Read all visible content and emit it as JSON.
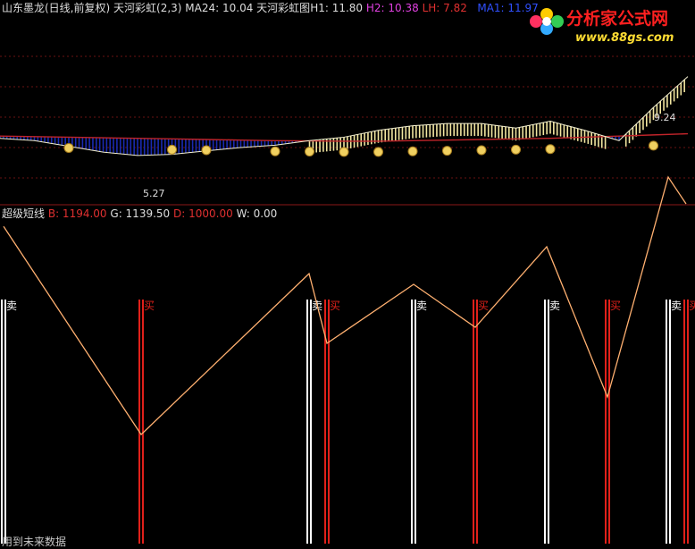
{
  "header_top": {
    "stock_title": "山东墨龙(日线,前复权)",
    "indicator": "天河彩虹(2,3)",
    "ma24": "MA24: 10.04",
    "rainbow": "天河彩虹图",
    "h1": "H1: 11.80",
    "h2": "H2: 10.38",
    "lh": "LH: 7.82",
    "ma1": "MA1: 11.97"
  },
  "header_bottom": {
    "name": "超级短线",
    "b": "B: 1194.00",
    "g": "G: 1139.50",
    "d": "D: 1000.00",
    "w": "W: 0.00"
  },
  "logo": {
    "cn": "分析家公式网",
    "url": "www.88gs.com"
  },
  "top_annotations": {
    "low_label": "5.27",
    "right_label": "9.24"
  },
  "footer_partial_text": "用到未来数据",
  "colors": {
    "buy": "#e0201a",
    "sell": "#ffffff",
    "line": "#ffb070",
    "ma_red": "#c0242a",
    "blue_band": "#1a2ab0",
    "yellow_bar": "#f2e6a0"
  },
  "chart_data": [
    {
      "type": "line",
      "panel": "top",
      "series": [
        {
          "name": "MA24",
          "values": [
            10.3,
            10.25,
            10.2,
            10.15,
            10.1,
            10.05,
            10.0,
            9.95,
            9.9,
            9.88,
            9.85,
            9.85,
            9.9,
            9.95,
            10.0,
            10.05,
            10.1,
            10.2,
            10.3,
            10.4,
            10.5
          ]
        },
        {
          "name": "MA1",
          "values": [
            10.1,
            9.9,
            9.4,
            8.9,
            8.6,
            8.7,
            9.0,
            9.3,
            9.5,
            9.9,
            10.2,
            10.8,
            11.2,
            11.4,
            11.4,
            11.0,
            11.6,
            10.8,
            9.9,
            12.8,
            15.5
          ]
        }
      ],
      "x": [
        0,
        1,
        2,
        3,
        4,
        5,
        6,
        7,
        8,
        9,
        10,
        11,
        12,
        13,
        14,
        15,
        16,
        17,
        18,
        19,
        20
      ]
    },
    {
      "type": "line",
      "panel": "bottom",
      "series": [
        {
          "values": [
            1194,
            1000,
            1150,
            1085,
            1140,
            1100,
            1175,
            1035,
            1240,
            1215
          ]
        }
      ],
      "x": [
        0,
        1,
        2,
        3,
        4,
        5,
        6,
        7,
        8,
        9
      ],
      "signals": [
        {
          "label": "卖",
          "kind": "sell"
        },
        {
          "label": "买",
          "kind": "buy"
        },
        {
          "label": "卖",
          "kind": "sell"
        },
        {
          "label": "买",
          "kind": "buy"
        },
        {
          "label": "卖",
          "kind": "sell"
        },
        {
          "label": "买",
          "kind": "buy"
        },
        {
          "label": "卖",
          "kind": "sell"
        },
        {
          "label": "买",
          "kind": "buy"
        },
        {
          "label": "卖",
          "kind": "sell"
        },
        {
          "label": "买",
          "kind": "buy"
        }
      ]
    }
  ]
}
